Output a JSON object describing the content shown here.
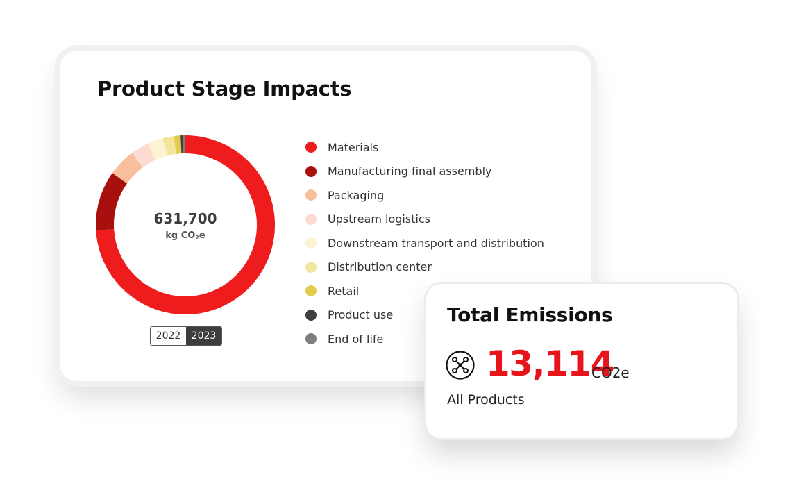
{
  "main_card": {
    "title": "Product Stage Impacts",
    "center_value": "631,700",
    "center_unit_prefix": "kg CO",
    "center_unit_sub": "2",
    "center_unit_suffix": "e",
    "years": [
      "2022",
      "2023"
    ],
    "selected_year": "2023"
  },
  "legend": [
    {
      "label": "Materials",
      "color": "#ee1c1c"
    },
    {
      "label": "Manufacturing final assembly",
      "color": "#a81010"
    },
    {
      "label": "Packaging",
      "color": "#f9bf9d"
    },
    {
      "label": "Upstream logistics",
      "color": "#fcdcd2"
    },
    {
      "label": "Downstream transport and distribution",
      "color": "#fbf3d2"
    },
    {
      "label": "Distribution center",
      "color": "#f2e59c"
    },
    {
      "label": "Retail",
      "color": "#e3cc4c"
    },
    {
      "label": "Product use",
      "color": "#3f3f3f"
    },
    {
      "label": "End of life",
      "color": "#7f7f7f"
    }
  ],
  "donut_shares": [
    0.74,
    0.108,
    0.05,
    0.033,
    0.028,
    0.02,
    0.012,
    0.004,
    0.005
  ],
  "side_card": {
    "title": "Total Emissions",
    "value": "13,114",
    "unit": "CO2e",
    "scope": "All Products",
    "icon": "drone-icon"
  },
  "colors": {
    "accent": "#e8141b"
  }
}
